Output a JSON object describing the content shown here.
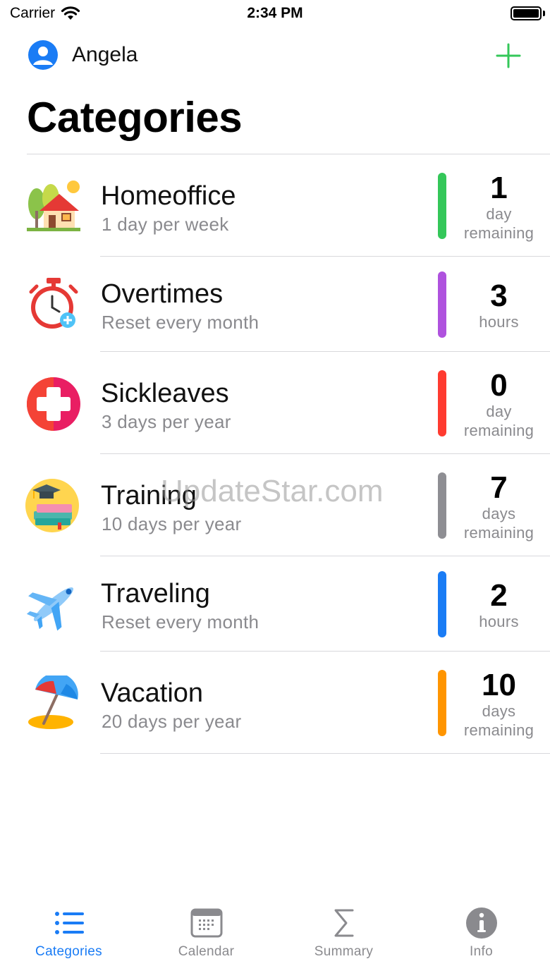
{
  "status_bar": {
    "carrier": "Carrier",
    "time": "2:34 PM"
  },
  "header": {
    "user_name": "Angela",
    "title": "Categories"
  },
  "colors": {
    "accent": "#1a7cf5",
    "add": "#34c759"
  },
  "categories": [
    {
      "name": "Homeoffice",
      "subtitle": "1 day per week",
      "value": "1",
      "unit": "day",
      "unit2": "remaining",
      "color": "#34c759",
      "icon": "house-trees-icon"
    },
    {
      "name": "Overtimes",
      "subtitle": "Reset every month",
      "value": "3",
      "unit": "hours",
      "unit2": "",
      "color": "#af52de",
      "icon": "stopwatch-icon"
    },
    {
      "name": "Sickleaves",
      "subtitle": "3 days per year",
      "value": "0",
      "unit": "day",
      "unit2": "remaining",
      "color": "#ff3b30",
      "icon": "medical-cross-icon"
    },
    {
      "name": "Training",
      "subtitle": "10 days per year",
      "value": "7",
      "unit": "days",
      "unit2": "remaining",
      "color": "#8e8e93",
      "icon": "graduation-books-icon"
    },
    {
      "name": "Traveling",
      "subtitle": "Reset every month",
      "value": "2",
      "unit": "hours",
      "unit2": "",
      "color": "#1a7cf5",
      "icon": "airplane-icon"
    },
    {
      "name": "Vacation",
      "subtitle": "20 days per year",
      "value": "10",
      "unit": "days",
      "unit2": "remaining",
      "color": "#ff9500",
      "icon": "beach-umbrella-icon"
    }
  ],
  "watermark": "UpdateStar.com",
  "tabs": [
    {
      "label": "Categories",
      "icon": "list-icon",
      "active": true
    },
    {
      "label": "Calendar",
      "icon": "calendar-icon",
      "active": false
    },
    {
      "label": "Summary",
      "icon": "sigma-icon",
      "active": false
    },
    {
      "label": "Info",
      "icon": "info-icon",
      "active": false
    }
  ]
}
